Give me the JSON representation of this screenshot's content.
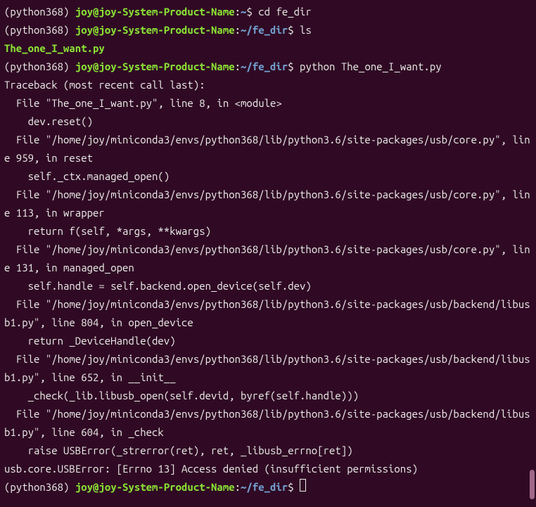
{
  "prompts": [
    {
      "env": "(python368) ",
      "user_host": "joy@joy-System-Product-Name",
      "colon": ":",
      "path": "~",
      "dollar": "$ ",
      "command": "cd fe_dir"
    },
    {
      "env": "(python368) ",
      "user_host": "joy@joy-System-Product-Name",
      "colon": ":",
      "path": "~/fe_dir",
      "dollar": "$ ",
      "command": "ls"
    }
  ],
  "ls_output": "The_one_I_want.py",
  "prompt3": {
    "env": "(python368) ",
    "user_host": "joy@joy-System-Product-Name",
    "colon": ":",
    "path": "~/fe_dir",
    "dollar": "$ ",
    "command": "python The_one_I_want.py"
  },
  "traceback": [
    "Traceback (most recent call last):",
    "  File \"The_one_I_want.py\", line 8, in <module>",
    "    dev.reset()",
    "  File \"/home/joy/miniconda3/envs/python368/lib/python3.6/site-packages/usb/core.py\", line 959, in reset",
    "    self._ctx.managed_open()",
    "  File \"/home/joy/miniconda3/envs/python368/lib/python3.6/site-packages/usb/core.py\", line 113, in wrapper",
    "    return f(self, *args, **kwargs)",
    "  File \"/home/joy/miniconda3/envs/python368/lib/python3.6/site-packages/usb/core.py\", line 131, in managed_open",
    "    self.handle = self.backend.open_device(self.dev)",
    "  File \"/home/joy/miniconda3/envs/python368/lib/python3.6/site-packages/usb/backend/libusb1.py\", line 804, in open_device",
    "    return _DeviceHandle(dev)",
    "  File \"/home/joy/miniconda3/envs/python368/lib/python3.6/site-packages/usb/backend/libusb1.py\", line 652, in __init__",
    "    _check(_lib.libusb_open(self.devid, byref(self.handle)))",
    "  File \"/home/joy/miniconda3/envs/python368/lib/python3.6/site-packages/usb/backend/libusb1.py\", line 604, in _check",
    "    raise USBError(_strerror(ret), ret, _libusb_errno[ret])",
    "usb.core.USBError: [Errno 13] Access denied (insufficient permissions)"
  ],
  "prompt4": {
    "env": "(python368) ",
    "user_host": "joy@joy-System-Product-Name",
    "colon": ":",
    "path": "~/fe_dir",
    "dollar": "$ ",
    "command": ""
  }
}
